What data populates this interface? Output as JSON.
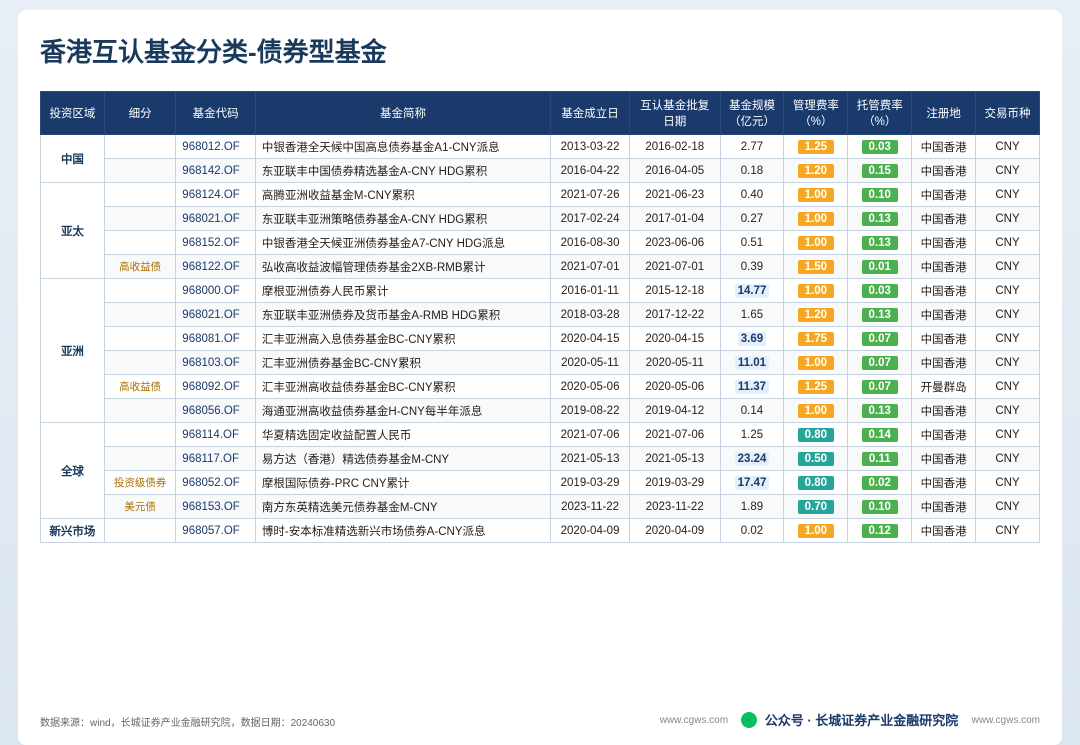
{
  "title": "香港互认基金分类-债券型基金",
  "headers": [
    "投资区域",
    "细分",
    "基金代码",
    "基金简称",
    "基金成立日",
    "互认基金批复日期",
    "基金规模（亿元）",
    "管理费率（%）",
    "托管费率（%）",
    "注册地",
    "交易币种"
  ],
  "rows": [
    {
      "region": "中国",
      "subtype": "",
      "code": "968012.OF",
      "name": "中银香港全天候中国高息债券基金A1-CNY派息",
      "found_date": "2013-03-22",
      "approve_date": "2016-02-18",
      "size": "2.77",
      "size_highlight": false,
      "mgmt": "1.25",
      "mgmt_color": "orange",
      "custody": "0.03",
      "custody_color": "green",
      "reg": "中国香港",
      "currency": "CNY"
    },
    {
      "region": "",
      "subtype": "",
      "code": "968142.OF",
      "name": "东亚联丰中国债券精选基金A-CNY HDG累积",
      "found_date": "2016-04-22",
      "approve_date": "2016-04-05",
      "size": "0.18",
      "size_highlight": false,
      "mgmt": "1.20",
      "mgmt_color": "orange",
      "custody": "0.15",
      "custody_color": "green",
      "reg": "中国香港",
      "currency": "CNY"
    },
    {
      "region": "亚太",
      "subtype": "",
      "code": "968124.OF",
      "name": "高腾亚洲收益基金M-CNY累积",
      "found_date": "2021-07-26",
      "approve_date": "2021-06-23",
      "size": "0.40",
      "size_highlight": false,
      "mgmt": "1.00",
      "mgmt_color": "orange",
      "custody": "0.10",
      "custody_color": "green",
      "reg": "中国香港",
      "currency": "CNY"
    },
    {
      "region": "",
      "subtype": "",
      "code": "968021.OF",
      "name": "东亚联丰亚洲策略债券基金A-CNY HDG累积",
      "found_date": "2017-02-24",
      "approve_date": "2017-01-04",
      "size": "0.27",
      "size_highlight": false,
      "mgmt": "1.00",
      "mgmt_color": "orange",
      "custody": "0.13",
      "custody_color": "green",
      "reg": "中国香港",
      "currency": "CNY"
    },
    {
      "region": "",
      "subtype": "",
      "code": "968152.OF",
      "name": "中银香港全天候亚洲债券基金A7-CNY HDG派息",
      "found_date": "2016-08-30",
      "approve_date": "2023-06-06",
      "size": "0.51",
      "size_highlight": false,
      "mgmt": "1.00",
      "mgmt_color": "orange",
      "custody": "0.13",
      "custody_color": "green",
      "reg": "中国香港",
      "currency": "CNY"
    },
    {
      "region": "",
      "subtype": "高收益债",
      "code": "968122.OF",
      "name": "弘收高收益波幅管理债券基金2XB-RMB累计",
      "found_date": "2021-07-01",
      "approve_date": "2021-07-01",
      "size": "0.39",
      "size_highlight": false,
      "mgmt": "1.50",
      "mgmt_color": "orange",
      "custody": "0.01",
      "custody_color": "green",
      "reg": "中国香港",
      "currency": "CNY"
    },
    {
      "region": "亚洲",
      "subtype": "",
      "code": "968000.OF",
      "name": "摩根亚洲债券人民币累计",
      "found_date": "2016-01-11",
      "approve_date": "2015-12-18",
      "size": "14.77",
      "size_highlight": true,
      "mgmt": "1.00",
      "mgmt_color": "orange",
      "custody": "0.03",
      "custody_color": "green",
      "reg": "中国香港",
      "currency": "CNY"
    },
    {
      "region": "",
      "subtype": "",
      "code": "968021.OF",
      "name": "东亚联丰亚洲债券及货币基金A-RMB HDG累积",
      "found_date": "2018-03-28",
      "approve_date": "2017-12-22",
      "size": "1.65",
      "size_highlight": false,
      "mgmt": "1.20",
      "mgmt_color": "orange",
      "custody": "0.13",
      "custody_color": "green",
      "reg": "中国香港",
      "currency": "CNY"
    },
    {
      "region": "",
      "subtype": "",
      "code": "968081.OF",
      "name": "汇丰亚洲高入息债券基金BC-CNY累积",
      "found_date": "2020-04-15",
      "approve_date": "2020-04-15",
      "size": "3.69",
      "size_highlight": true,
      "mgmt": "1.75",
      "mgmt_color": "orange",
      "custody": "0.07",
      "custody_color": "green",
      "reg": "中国香港",
      "currency": "CNY"
    },
    {
      "region": "",
      "subtype": "",
      "code": "968103.OF",
      "name": "汇丰亚洲债券基金BC-CNY累积",
      "found_date": "2020-05-11",
      "approve_date": "2020-05-11",
      "size": "11.01",
      "size_highlight": true,
      "mgmt": "1.00",
      "mgmt_color": "orange",
      "custody": "0.07",
      "custody_color": "green",
      "reg": "中国香港",
      "currency": "CNY"
    },
    {
      "region": "",
      "subtype": "高收益债",
      "code": "968092.OF",
      "name": "汇丰亚洲高收益债券基金BC-CNY累积",
      "found_date": "2020-05-06",
      "approve_date": "2020-05-06",
      "size": "11.37",
      "size_highlight": true,
      "mgmt": "1.25",
      "mgmt_color": "orange",
      "custody": "0.07",
      "custody_color": "green",
      "reg": "开曼群岛",
      "currency": "CNY"
    },
    {
      "region": "",
      "subtype": "",
      "code": "968056.OF",
      "name": "海通亚洲高收益债券基金H-CNY每半年派息",
      "found_date": "2019-08-22",
      "approve_date": "2019-04-12",
      "size": "0.14",
      "size_highlight": false,
      "mgmt": "1.00",
      "mgmt_color": "orange",
      "custody": "0.13",
      "custody_color": "green",
      "reg": "中国香港",
      "currency": "CNY"
    },
    {
      "region": "全球",
      "subtype": "",
      "code": "968114.OF",
      "name": "华夏精选固定收益配置人民币",
      "found_date": "2021-07-06",
      "approve_date": "2021-07-06",
      "size": "1.25",
      "size_highlight": false,
      "mgmt": "0.80",
      "mgmt_color": "teal",
      "custody": "0.14",
      "custody_color": "green",
      "reg": "中国香港",
      "currency": "CNY"
    },
    {
      "region": "",
      "subtype": "",
      "code": "968117.OF",
      "name": "易方达（香港）精选债券基金M-CNY",
      "found_date": "2021-05-13",
      "approve_date": "2021-05-13",
      "size": "23.24",
      "size_highlight": true,
      "mgmt": "0.50",
      "mgmt_color": "teal",
      "custody": "0.11",
      "custody_color": "green",
      "reg": "中国香港",
      "currency": "CNY"
    },
    {
      "region": "",
      "subtype": "投资级债券",
      "code": "968052.OF",
      "name": "摩根国际债券-PRC CNY累计",
      "found_date": "2019-03-29",
      "approve_date": "2019-03-29",
      "size": "17.47",
      "size_highlight": true,
      "mgmt": "0.80",
      "mgmt_color": "teal",
      "custody": "0.02",
      "custody_color": "green",
      "reg": "中国香港",
      "currency": "CNY"
    },
    {
      "region": "",
      "subtype": "美元债",
      "code": "968153.OF",
      "name": "南方东英精选美元债券基金M-CNY",
      "found_date": "2023-11-22",
      "approve_date": "2023-11-22",
      "size": "1.89",
      "size_highlight": false,
      "mgmt": "0.70",
      "mgmt_color": "teal",
      "custody": "0.10",
      "custody_color": "green",
      "reg": "中国香港",
      "currency": "CNY"
    },
    {
      "region": "新兴市场",
      "subtype": "",
      "code": "968057.OF",
      "name": "博时-安本标准精选新兴市场债券A-CNY派息",
      "found_date": "2020-04-09",
      "approve_date": "2020-04-09",
      "size": "0.02",
      "size_highlight": false,
      "mgmt": "1.00",
      "mgmt_color": "orange",
      "custody": "0.12",
      "custody_color": "green",
      "reg": "中国香港",
      "currency": "CNY"
    }
  ],
  "footer": {
    "left": "数据来源：wind，长城证券产业金融研究院，数据日期：20240630",
    "brand_url1": "www.cgws.com",
    "brand_label": "公众号 · 长城证券产业金融研究院",
    "brand_url2": "www.cgws.com"
  }
}
